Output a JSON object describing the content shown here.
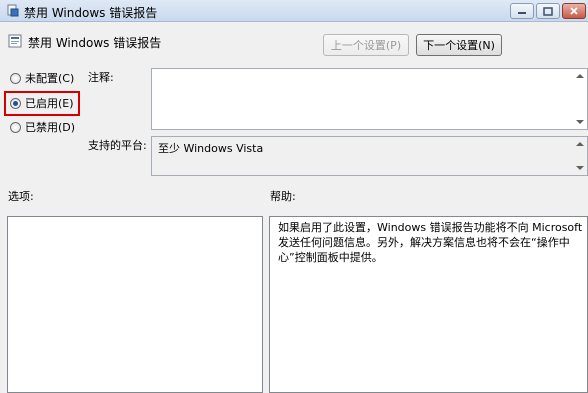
{
  "window": {
    "title": "禁用 Windows 错误报告"
  },
  "header": {
    "title": "禁用 Windows 错误报告",
    "prev_button": "上一个设置(P)",
    "next_button": "下一个设置(N)"
  },
  "state": {
    "options": [
      {
        "label": "未配置(C)",
        "selected": false
      },
      {
        "label": "已启用(E)",
        "selected": true
      },
      {
        "label": "已禁用(D)",
        "selected": false
      }
    ]
  },
  "comment": {
    "label": "注释:",
    "value": ""
  },
  "platform": {
    "label": "支持的平台:",
    "value": "至少 Windows Vista"
  },
  "options_panel": {
    "label": "选项:"
  },
  "help_panel": {
    "label": "帮助:",
    "text": "如果启用了此设置，Windows 错误报告功能将不向 Microsoft 发送任何问题信息。另外，解决方案信息也将不会在“操作中心”控制面板中提供。"
  },
  "colors": {
    "highlight": "#d40000",
    "selected_radio": "#1f4f9a"
  }
}
